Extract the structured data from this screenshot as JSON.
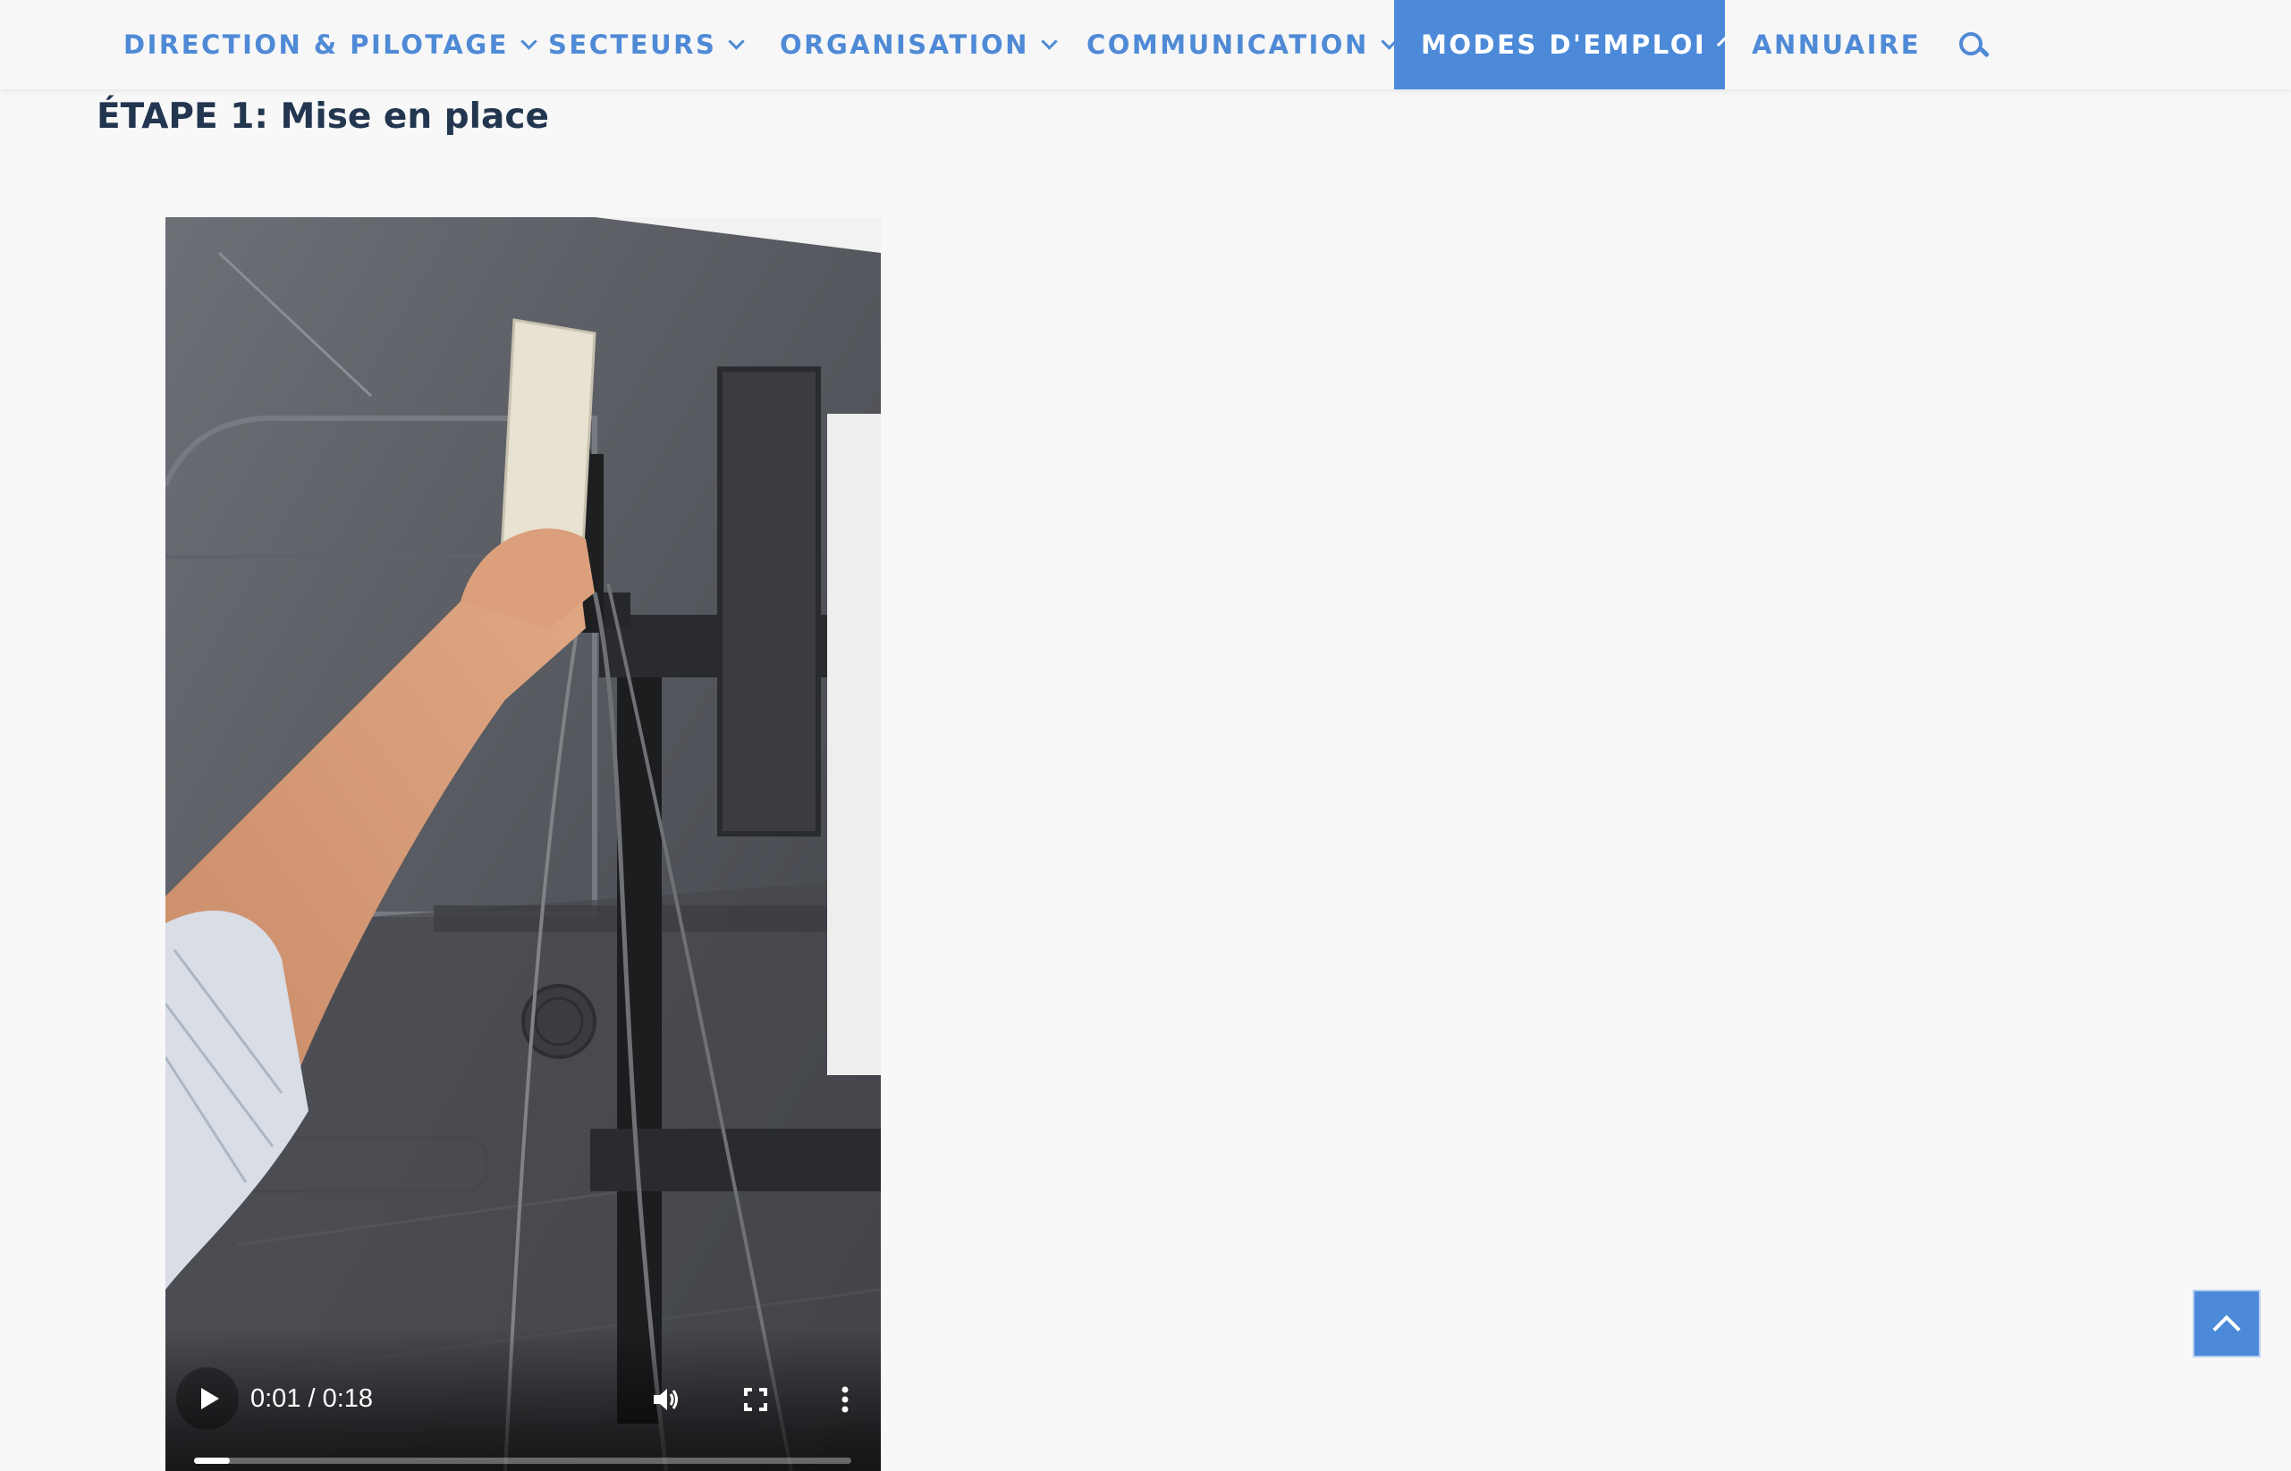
{
  "nav": {
    "items": [
      {
        "label": "DIRECTION & PILOTAGE",
        "has_dropdown": true,
        "active": false
      },
      {
        "label": "SECTEURS",
        "has_dropdown": true,
        "active": false
      },
      {
        "label": "ORGANISATION",
        "has_dropdown": true,
        "active": false
      },
      {
        "label": "COMMUNICATION",
        "has_dropdown": true,
        "active": false
      },
      {
        "label": "MODES D'EMPLOI",
        "has_dropdown": true,
        "active": true
      },
      {
        "label": "ANNUAIRE",
        "has_dropdown": false,
        "active": false
      }
    ],
    "search_icon": "search-icon"
  },
  "content": {
    "heading": "ÉTAPE 1: Mise en place"
  },
  "video": {
    "state": "paused",
    "time_display": "0:01 / 0:18",
    "current_time": "0:01",
    "duration": "0:18",
    "progress_fraction": 0.055,
    "controls": [
      "play-icon",
      "volume-icon",
      "fullscreen-icon",
      "more-options-icon"
    ]
  },
  "back_to_top": {
    "icon": "chevron-up-icon"
  },
  "colors": {
    "accent": "#4c8ad9",
    "nav_text": "#4f8ad6",
    "heading_text": "#233650",
    "page_background": "#f8f8f8"
  }
}
